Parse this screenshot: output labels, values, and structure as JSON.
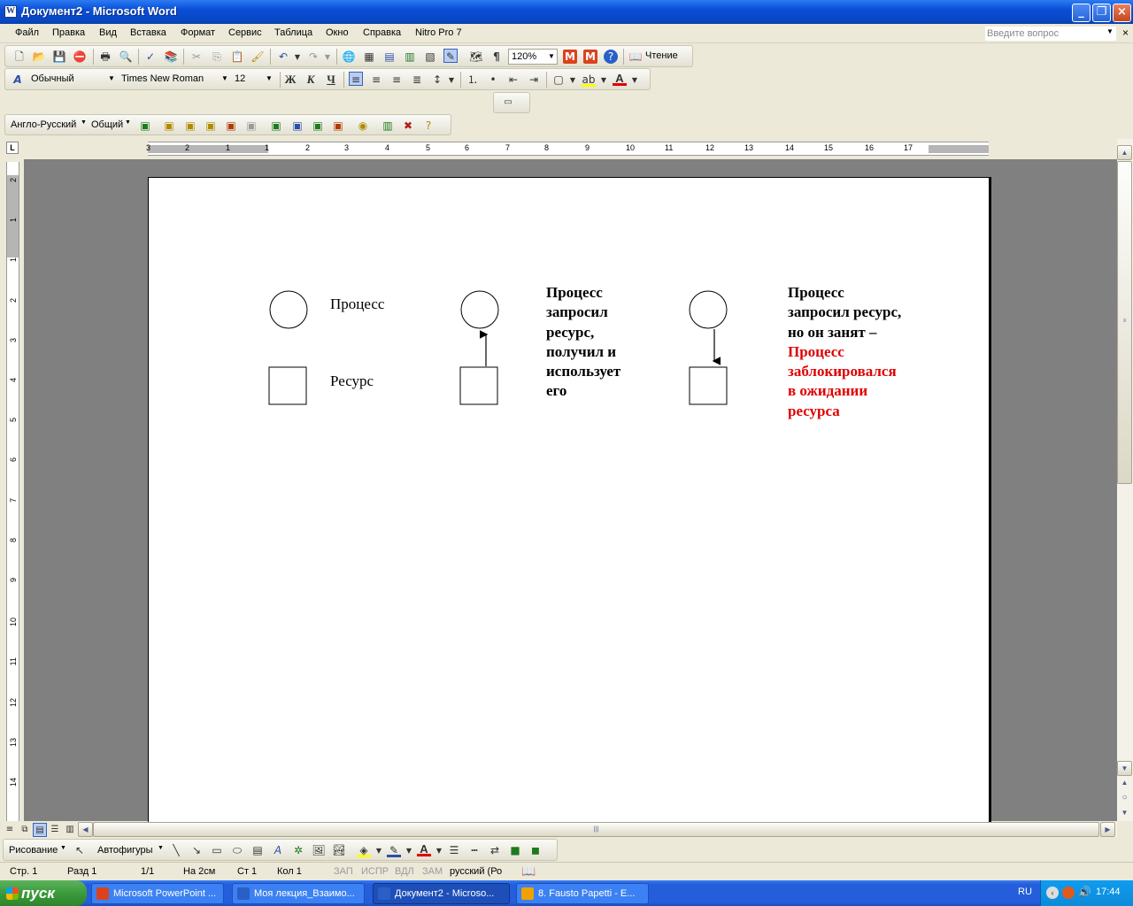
{
  "window": {
    "title": "Документ2 - Microsoft Word"
  },
  "menu": {
    "items": [
      "Файл",
      "Правка",
      "Вид",
      "Вставка",
      "Формат",
      "Сервис",
      "Таблица",
      "Окно",
      "Справка",
      "Nitro Pro 7"
    ],
    "help_placeholder": "Введите вопрос"
  },
  "toolbar_standard": {
    "zoom": "120%",
    "reading_label": "Чтение"
  },
  "toolbar_format": {
    "style": "Обычный",
    "font": "Times New Roman",
    "size": "12"
  },
  "toolbar_translate": {
    "dictionary": "Англо-Русский",
    "topic": "Общий"
  },
  "ruler": {
    "h_ticks": [
      "3",
      "2",
      "1",
      "1",
      "2",
      "3",
      "4",
      "5",
      "6",
      "7",
      "8",
      "9",
      "10",
      "11",
      "12",
      "13",
      "14",
      "15",
      "16",
      "17"
    ],
    "v_ticks": [
      "2",
      "1",
      "1",
      "2",
      "3",
      "4",
      "5",
      "6",
      "7",
      "8",
      "9",
      "10",
      "11",
      "12",
      "13",
      "14"
    ]
  },
  "document": {
    "col1": {
      "label_process": "Процесс",
      "label_resource": "Ресурс"
    },
    "col2": {
      "lines": [
        "Процесс",
        "запросил",
        "ресурс,",
        "получил и",
        "использует",
        "его"
      ]
    },
    "col3": {
      "lines_black": [
        "Процесс",
        "запросил ресурс,",
        "но он занят –"
      ],
      "lines_red": [
        "Процесс",
        "заблокировался",
        "в ожидании",
        "ресурса"
      ]
    }
  },
  "drawing_toolbar": {
    "drawing_label": "Рисование",
    "autoshapes_label": "Автофигуры"
  },
  "status": {
    "page": "Стр. 1",
    "section": "Разд 1",
    "pages": "1/1",
    "at": "На 2см",
    "line": "Ст 1",
    "col": "Кол 1",
    "rec": "ЗАП",
    "trk": "ИСПР",
    "ext": "ВДЛ",
    "ovr": "ЗАМ",
    "lang": "русский (Ро"
  },
  "taskbar": {
    "start_label": "пуск",
    "tasks": [
      "Microsoft PowerPoint ...",
      "Моя лекция_Взаимо...",
      "Документ2 - Microso...",
      "8. Fausto Papetti - E..."
    ],
    "lang": "RU",
    "time": "17:44"
  },
  "colors": {
    "accent_red": "#e00000",
    "title_blue": "#0a4fd6"
  }
}
